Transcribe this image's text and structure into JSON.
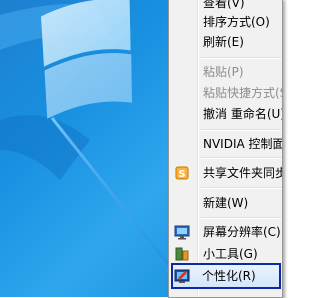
{
  "menu": {
    "items": [
      {
        "label": "查看(V)",
        "disabled": false
      },
      {
        "label": "排序方式(O)",
        "disabled": false
      },
      {
        "label": "刷新(E)",
        "disabled": false
      },
      {
        "label": "粘贴(P)",
        "disabled": true
      },
      {
        "label": "粘贴快捷方式(S)",
        "disabled": true
      },
      {
        "label": "撤消 重命名(U)",
        "disabled": false
      },
      {
        "label": "NVIDIA 控制面板",
        "disabled": false
      },
      {
        "label": "共享文件夹同步",
        "disabled": false
      },
      {
        "label": "新建(W)",
        "disabled": false
      },
      {
        "label": "屏幕分辨率(C)",
        "disabled": false
      },
      {
        "label": "小工具(G)",
        "disabled": false
      },
      {
        "label": "个性化(R)",
        "disabled": false,
        "highlighted": true
      }
    ]
  },
  "colors": {
    "desktop_blue": "#1890e0",
    "highlight_border": "#0a2aa8",
    "arrow": "#3aa0f5"
  }
}
